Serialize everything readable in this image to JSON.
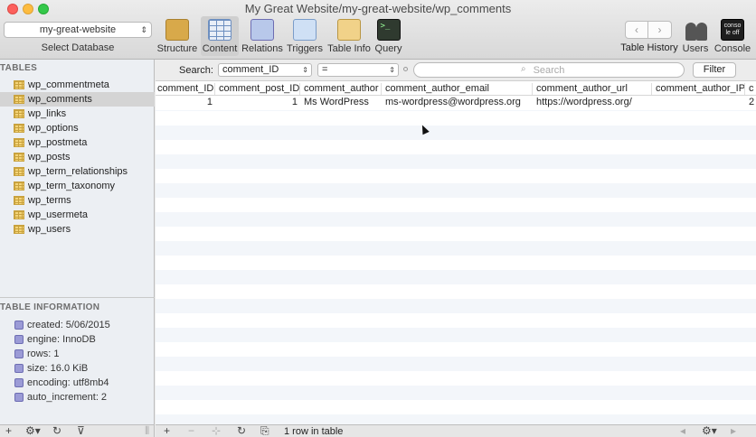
{
  "window": {
    "title": "My Great Website/my-great-website/wp_comments"
  },
  "database": {
    "selected": "my-great-website",
    "caption": "Select Database"
  },
  "toolbar": {
    "structure": "Structure",
    "content": "Content",
    "relations": "Relations",
    "triggers": "Triggers",
    "table_info": "Table Info",
    "query": "Query",
    "table_history": "Table History",
    "users": "Users",
    "console": "Console",
    "console_icon_text": "conso le off"
  },
  "sidebar": {
    "tables_header": "TABLES",
    "tables": [
      "wp_commentmeta",
      "wp_comments",
      "wp_links",
      "wp_options",
      "wp_postmeta",
      "wp_posts",
      "wp_term_relationships",
      "wp_term_taxonomy",
      "wp_terms",
      "wp_usermeta",
      "wp_users"
    ],
    "selected_table": "wp_comments",
    "info_header": "TABLE INFORMATION",
    "info": [
      "created: 5/06/2015",
      "engine: InnoDB",
      "rows: 1",
      "size: 16.0 KiB",
      "encoding: utf8mb4",
      "auto_increment: 2"
    ]
  },
  "filter": {
    "label": "Search:",
    "field": "comment_ID",
    "operator": "=",
    "placeholder": "Search",
    "button": "Filter"
  },
  "grid": {
    "columns": [
      "comment_ID",
      "comment_post_ID",
      "comment_author",
      "comment_author_email",
      "comment_author_url",
      "comment_author_IP",
      "c"
    ],
    "rows": [
      [
        "1",
        "1",
        "Ms WordPress",
        "ms-wordpress@wordpress.org",
        "https://wordpress.org/",
        "",
        "2"
      ]
    ]
  },
  "status": {
    "row_count": "1 row in table"
  }
}
